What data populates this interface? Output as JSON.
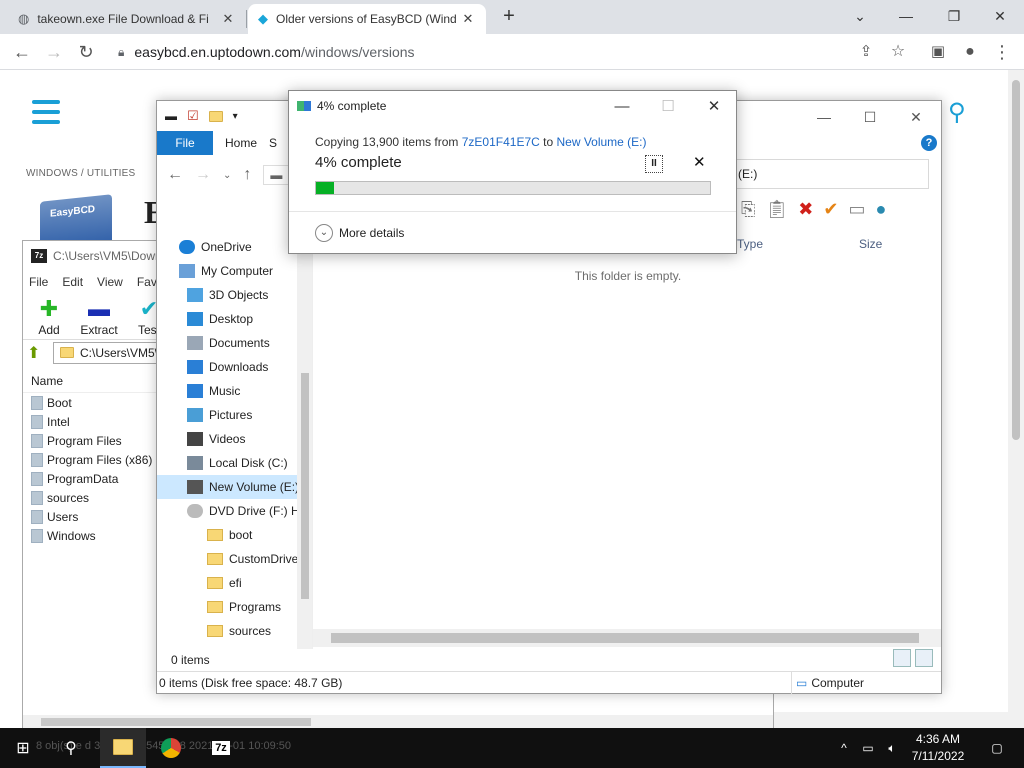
{
  "browser": {
    "tabs": [
      {
        "title": "takeown.exe File Download & Fi",
        "active": false
      },
      {
        "title": "Older versions of EasyBCD (Wind",
        "active": true
      }
    ],
    "url_host": "easybcd.en.uptodown.com",
    "url_path": "/windows/versions"
  },
  "webpage": {
    "breadcrumb": "WINDOWS  /  UTILITIES",
    "logo_text": "EasyBCD",
    "heading_partial": "E"
  },
  "sevenzip": {
    "title": "C:\\Users\\VM5\\Down",
    "menu": [
      "File",
      "Edit",
      "View",
      "Favo"
    ],
    "tools": [
      {
        "label": "Add",
        "color": "#27b627"
      },
      {
        "label": "Extract",
        "color": "#1a2fb3"
      },
      {
        "label": "Test",
        "color": "#1ab3c9"
      }
    ],
    "path": "C:\\Users\\VM5\\",
    "column_name": "Name",
    "items": [
      "Boot",
      "Intel",
      "Program Files",
      "Program Files (x86)",
      "ProgramData",
      "sources",
      "Users",
      "Windows"
    ],
    "status_behind": "8 obj(s)     e d       3 081 852 545        288              2021-07-01 10:09:50"
  },
  "explorer": {
    "tab_file": "File",
    "tab_home": "Home",
    "tab_partial": "S",
    "help": "?",
    "address_tail": "(E:)",
    "col_type": "Type",
    "col_size": "Size",
    "nav": [
      {
        "label": "OneDrive",
        "indent": 0,
        "icon": "onedrive-icon",
        "color": "#1b7fd6"
      },
      {
        "label": "My Computer",
        "indent": 0,
        "icon": "computer-icon",
        "color": "#6aa0d8"
      },
      {
        "label": "3D Objects",
        "indent": 1,
        "icon": "cube-icon",
        "color": "#4fa3e0"
      },
      {
        "label": "Desktop",
        "indent": 1,
        "icon": "desktop-icon",
        "color": "#2a8ad6"
      },
      {
        "label": "Documents",
        "indent": 1,
        "icon": "documents-icon",
        "color": "#9aa7b6"
      },
      {
        "label": "Downloads",
        "indent": 1,
        "icon": "download-icon",
        "color": "#2a7fd6"
      },
      {
        "label": "Music",
        "indent": 1,
        "icon": "music-icon",
        "color": "#2a7fd6"
      },
      {
        "label": "Pictures",
        "indent": 1,
        "icon": "pictures-icon",
        "color": "#4a9ed6"
      },
      {
        "label": "Videos",
        "indent": 1,
        "icon": "video-icon",
        "color": "#444444"
      },
      {
        "label": "Local Disk (C:)",
        "indent": 1,
        "icon": "drive-icon",
        "color": "#7a8a9a"
      },
      {
        "label": "New Volume (E:)",
        "indent": 1,
        "icon": "drive-icon",
        "color": "#555555",
        "selected": true
      },
      {
        "label": "DVD Drive (F:) H",
        "indent": 1,
        "icon": "dvd-icon",
        "color": "#bbbbbb"
      },
      {
        "label": "boot",
        "indent": 2,
        "icon": "folder-icon",
        "color": "#f8d775"
      },
      {
        "label": "CustomDrivers",
        "indent": 2,
        "icon": "folder-icon",
        "color": "#f8d775"
      },
      {
        "label": "efi",
        "indent": 2,
        "icon": "folder-icon",
        "color": "#f8d775"
      },
      {
        "label": "Programs",
        "indent": 2,
        "icon": "folder-icon",
        "color": "#f8d775"
      },
      {
        "label": "sources",
        "indent": 2,
        "icon": "folder-icon",
        "color": "#f8d775"
      }
    ],
    "empty_text": "This folder is empty.",
    "item_count": "0 items",
    "status_bottom": "0 items (Disk free space: 48.7 GB)",
    "computer_label": "Computer"
  },
  "copy_dialog": {
    "title": "4% complete",
    "copying_prefix": "Copying 13,900 items from ",
    "source": "7zE01F41E7C",
    "to_word": " to ",
    "destination": "New Volume (E:)",
    "percent_text": "4% complete",
    "progress": 0.045,
    "pause_symbol": "II",
    "cancel_symbol": "✕",
    "more_details": "More details",
    "accent_color": "#06b025"
  },
  "taskbar": {
    "time": "4:36 AM",
    "date": "7/11/2022",
    "sevenzip_label": "7z"
  }
}
